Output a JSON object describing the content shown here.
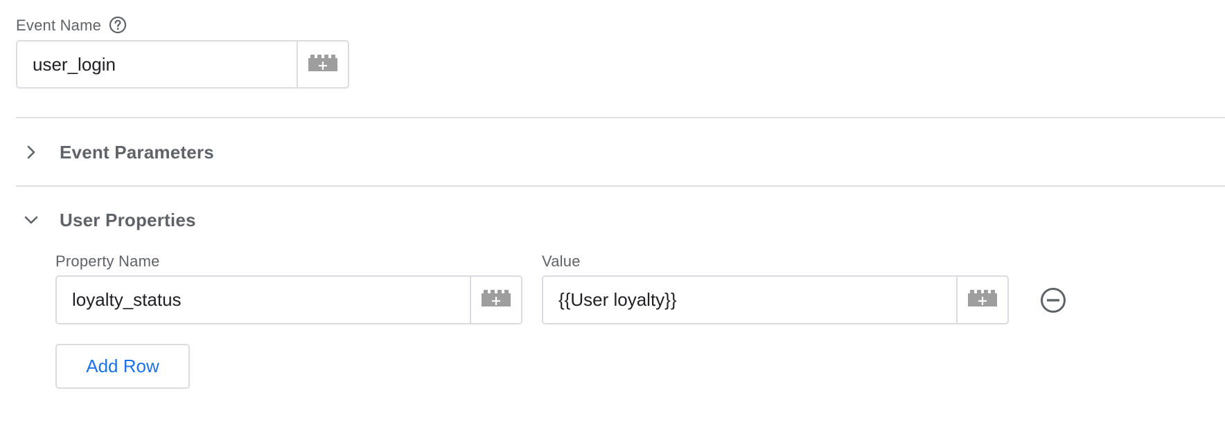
{
  "event_name": {
    "label": "Event Name",
    "help_icon": "help-circle-icon",
    "value": "user_login",
    "variable_icon": "variable-brick-icon"
  },
  "sections": {
    "event_parameters": {
      "title": "Event Parameters",
      "expanded": false,
      "icon": "chevron-right-icon"
    },
    "user_properties": {
      "title": "User Properties",
      "expanded": true,
      "icon": "chevron-down-icon",
      "columns": {
        "property_name": "Property Name",
        "value": "Value"
      },
      "rows": [
        {
          "property_name": "loyalty_status",
          "value": "{{User loyalty}}"
        }
      ],
      "remove_icon": "remove-circle-icon",
      "add_row_label": "Add Row"
    }
  },
  "colors": {
    "accent": "#1a73e8",
    "label": "#5f6368",
    "border": "#dadce0",
    "icon": "#9e9e9e"
  }
}
